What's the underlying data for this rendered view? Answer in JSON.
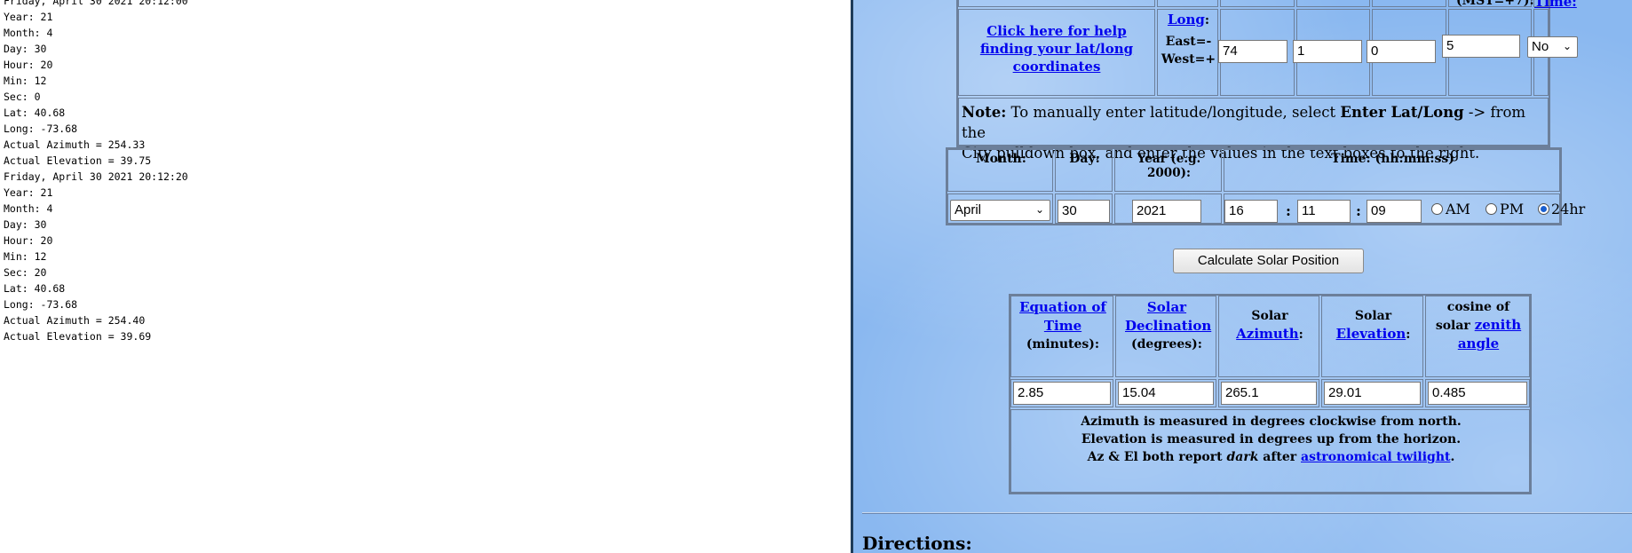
{
  "console": {
    "lines": [
      "Friday, April 30 2021 20:12:00",
      "Year: 21",
      "Month: 4",
      "Day: 30",
      "Hour: 20",
      "Min: 12",
      "Sec: 0",
      "Lat: 40.68",
      "Long: -73.68",
      "Actual Azimuth = 254.33",
      "Actual Elevation = 39.75",
      "Friday, April 30 2021 20:12:20",
      "Year: 21",
      "Month: 4",
      "Day: 30",
      "Hour: 20",
      "Min: 12",
      "Sec: 20",
      "Lat: 40.68",
      "Long: -73.68",
      "Actual Azimuth = 254.40",
      "Actual Elevation = 39.69"
    ]
  },
  "location": {
    "top_partial_label": "(MST=+7):",
    "top_partial_link": "Time:",
    "help_link": "Click here for help finding your lat/long coordinates",
    "long_link": "Long",
    "long_label_suffix": ":",
    "east_label": "East=-",
    "west_label": "West=+",
    "long_degrees": "74",
    "long_minutes": "1",
    "long_seconds": "0",
    "timezone": "5",
    "dst_selected": "No",
    "note_bold": "Note:",
    "note_text_1": " To manually enter latitude/longitude, select ",
    "note_bold_2": "Enter Lat/Long",
    "note_text_2": " -> from the",
    "note_text_3": "City pulldown box, and enter the values in the text boxes to the right."
  },
  "datetime": {
    "month_label": "Month:",
    "day_label": "Day:",
    "year_label": "Year (e.g. 2000):",
    "time_label": "Time: (hh:mm:ss)",
    "month_selected": "April",
    "day": "30",
    "year": "2021",
    "hour": "16",
    "minute": "11",
    "second": "09",
    "colon": ":",
    "am_label": "AM",
    "pm_label": "PM",
    "h24_label": "24hr",
    "selected_mode": "24hr"
  },
  "calculate_button": "Calculate Solar Position",
  "results": {
    "eot_link": "Equation of Time",
    "eot_unit": "(minutes):",
    "decl_link": "Solar Declination",
    "decl_unit": "(degrees):",
    "az_prefix": "Solar",
    "az_link": "Azimuth",
    "az_suffix": ":",
    "el_prefix": "Solar",
    "el_link": "Elevation",
    "el_suffix": ":",
    "cz_prefix": "cosine of",
    "cz_prefix2": "solar",
    "cz_link": "zenith angle",
    "eot_value": "2.85",
    "decl_value": "15.04",
    "az_value": "265.1",
    "el_value": "29.01",
    "cz_value": "0.485",
    "note_line1": "Azimuth is measured in degrees clockwise from north.",
    "note_line2": "Elevation is measured in degrees up from the horizon.",
    "note_line3_a": "Az & El both report ",
    "note_line3_em": "dark",
    "note_line3_b": " after ",
    "note_line3_link": "astronomical twilight",
    "note_line3_end": "."
  },
  "directions_heading": "Directions:",
  "colors": {
    "background": "#8ab8f0",
    "link": "#0000ee",
    "border": "#6c7f9a"
  }
}
